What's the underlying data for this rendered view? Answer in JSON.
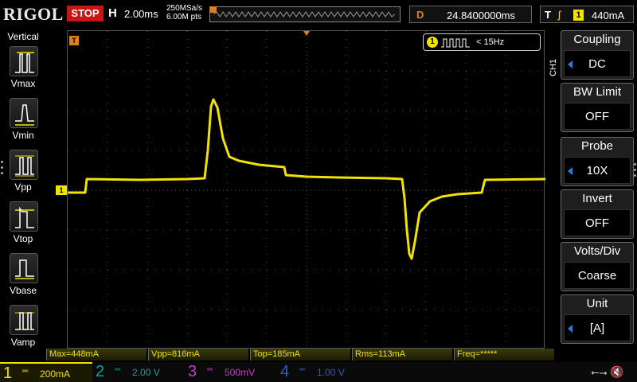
{
  "topbar": {
    "logo": "RIGOL",
    "run_state": "STOP",
    "horizontal_label": "H",
    "timebase": "2.00ms",
    "sample_rate": "250MSa/s",
    "memory_depth": "6.00M pts",
    "delay_label": "D",
    "delay_value": "24.8400000ms",
    "trigger_label": "T",
    "trigger_edge": "ʃ",
    "trigger_source": "1",
    "trigger_level": "440mA"
  },
  "left_menu": {
    "title": "Vertical",
    "items": [
      {
        "label": "Vmax",
        "icon": "vmax-icon"
      },
      {
        "label": "Vmin",
        "icon": "vmin-icon"
      },
      {
        "label": "Vpp",
        "icon": "vpp-icon"
      },
      {
        "label": "Vtop",
        "icon": "vtop-icon"
      },
      {
        "label": "Vbase",
        "icon": "vbase-icon"
      },
      {
        "label": "Vamp",
        "icon": "vamp-icon"
      }
    ]
  },
  "screen": {
    "freq_counter_channel": "1",
    "freq_counter_text": "< 15Hz",
    "trigger_marker": "T",
    "channel_marker": "1"
  },
  "right_menu": {
    "channel_tag": "CH1",
    "items": [
      {
        "label": "Coupling",
        "value": "DC"
      },
      {
        "label": "BW Limit",
        "value": "OFF"
      },
      {
        "label": "Probe",
        "value": "10X"
      },
      {
        "label": "Invert",
        "value": "OFF"
      },
      {
        "label": "Volts/Div",
        "value": "Coarse"
      },
      {
        "label": "Unit",
        "value": "[A]"
      }
    ]
  },
  "measurements": [
    "Max=448mA",
    "Vpp=816mA",
    "Top=185mA",
    "Rms=113mA",
    "Freq=*****"
  ],
  "channels": [
    {
      "num": "1",
      "scale": "200mA",
      "color": "#f2e200",
      "active": true
    },
    {
      "num": "2",
      "scale": "2.00 V",
      "color": "#14a0a0",
      "active": false
    },
    {
      "num": "3",
      "scale": "500mV",
      "color": "#c040c0",
      "active": false
    },
    {
      "num": "4",
      "scale": "1.00 V",
      "color": "#2060d0",
      "active": false
    }
  ],
  "colors": {
    "ch1": "#f2e200",
    "stop": "#c81414",
    "marker": "#e0801c",
    "accent": "#2a7fd4"
  }
}
